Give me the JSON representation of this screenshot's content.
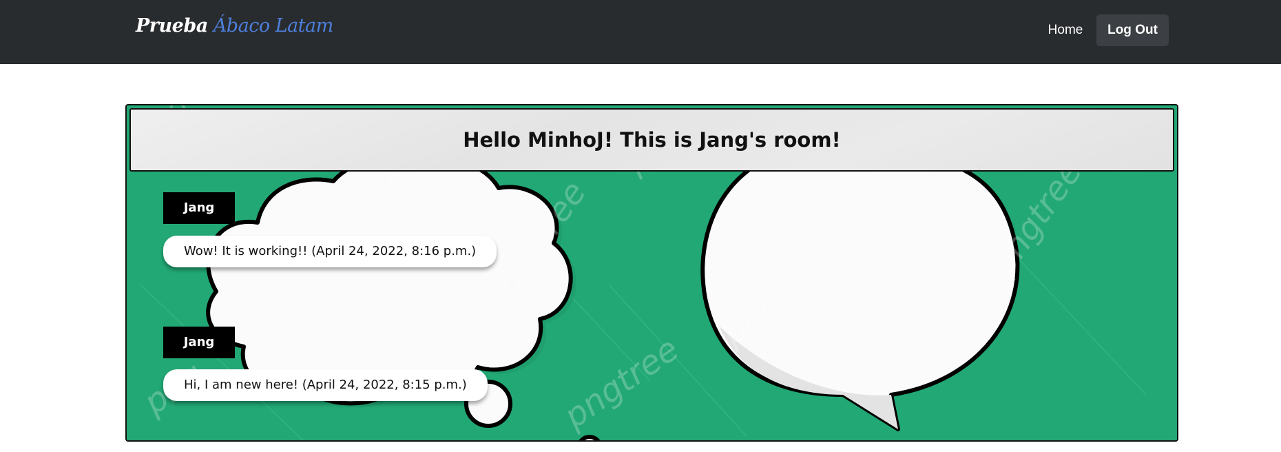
{
  "navbar": {
    "brand_part1": "Prueba",
    "brand_part2": "Ábaco Latam",
    "home_label": "Home",
    "logout_label": "Log Out"
  },
  "room": {
    "title": "Hello MinhoJ! This is Jang's room!",
    "messages": [
      {
        "user": "Jang",
        "text": "Wow! It is working!! (April 24, 2022, 8:16 p.m.)"
      },
      {
        "user": "Jang",
        "text": "Hi, I am new here! (April 24, 2022, 8:15 p.m.)"
      }
    ]
  },
  "colors": {
    "navbar_bg": "#292c2f",
    "brand_accent": "#4d7fdc",
    "room_bg": "#22a874",
    "header_bg": "#e8e8e8",
    "user_badge_bg": "#000000"
  },
  "icons": {
    "background": "comic-speech-bubbles-image"
  }
}
